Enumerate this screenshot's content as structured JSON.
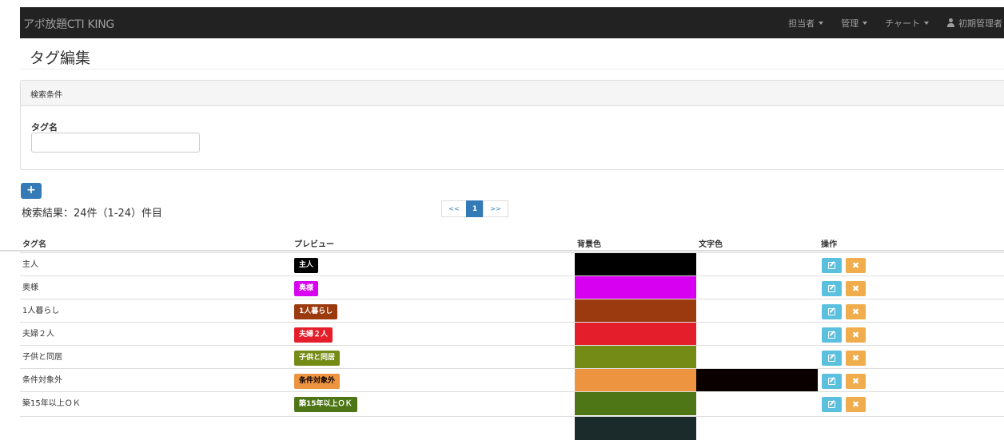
{
  "navbar": {
    "brand": "アポ放題CTI KING",
    "menus": [
      "担当者",
      "管理",
      "チャート"
    ],
    "user": "初期管理者"
  },
  "page": {
    "title": "タグ編集"
  },
  "search": {
    "heading": "検索条件",
    "field_label": "タグ名",
    "field_value": "",
    "field_placeholder": ""
  },
  "toolbar": {
    "add_label": "+"
  },
  "results": {
    "summary": "検索結果：24件（1-24）件目"
  },
  "pagination": {
    "prev": "<<",
    "current": "1",
    "next": ">>"
  },
  "table": {
    "headers": [
      "タグ名",
      "プレビュー",
      "背景色",
      "文字色",
      "操作"
    ],
    "rows": [
      {
        "name": "主人",
        "preview": "主人",
        "bg": "#000000",
        "fg": "#ffffff"
      },
      {
        "name": "奥様",
        "preview": "奥様",
        "bg": "#d800f0",
        "fg": "#ffffff"
      },
      {
        "name": "1人暮らし",
        "preview": "1人暮らし",
        "bg": "#9b3a0e",
        "fg": "#ffffff"
      },
      {
        "name": "夫婦２人",
        "preview": "夫婦２人",
        "bg": "#e41e2b",
        "fg": "#ffffff"
      },
      {
        "name": "子供と同居",
        "preview": "子供と同居",
        "bg": "#748c16",
        "fg": "#ffffff"
      },
      {
        "name": "条件対象外",
        "preview": "条件対象外",
        "bg": "#ec9440",
        "fg": "#0b0000"
      },
      {
        "name": "築15年以上ＯＫ",
        "preview": "築15年以上ＯＫ",
        "bg": "#4e7616",
        "fg": "#ffffff"
      }
    ],
    "delete_label": "✖"
  },
  "colors": {
    "navbar": "#222222",
    "primary": "#337ab7",
    "info": "#5bc0de",
    "warning": "#f0ad4e"
  }
}
